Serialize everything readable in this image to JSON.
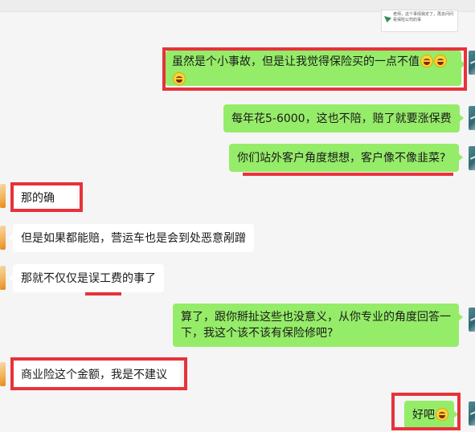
{
  "top_thumbnail": {
    "line1": "老师，这个事情我定了，再去问问",
    "line2": "看保险公司的事"
  },
  "messages": [
    {
      "id": "m1",
      "side": "right",
      "text_line1": "虽然是个小事故，但是让我觉得保险买的一点不值",
      "emoji": [
        "smile-tear-emoji",
        "smile-tear-emoji",
        "smile-tear-emoji"
      ]
    },
    {
      "id": "m2",
      "side": "right",
      "text": "每年花5-6000，这也不陪，赔了就要涨保费"
    },
    {
      "id": "m3",
      "side": "right",
      "text": "你们站外客户角度想想，客户像不像韭菜?"
    },
    {
      "id": "m4",
      "side": "left",
      "text": "那的确"
    },
    {
      "id": "m5",
      "side": "left",
      "text": "但是如果都能赔，营运车也是会到处恶意剐蹭"
    },
    {
      "id": "m6",
      "side": "left",
      "text": "那就不仅仅是误工费的事了"
    },
    {
      "id": "m7",
      "side": "right",
      "text": "算了，跟你掰扯这些也没意义，从你专业的角度回答一下，我这个该不该有保险修吧?"
    },
    {
      "id": "m8",
      "side": "left",
      "text": "商业险这个金额，我是不建议"
    },
    {
      "id": "m9",
      "side": "right",
      "text": "好吧",
      "emoji": [
        "grin-emoji"
      ]
    }
  ],
  "colors": {
    "sent_bubble": "#95ec69",
    "received_bubble": "#ffffff",
    "highlight": "#e8323a",
    "background": "#f5f5f5"
  }
}
